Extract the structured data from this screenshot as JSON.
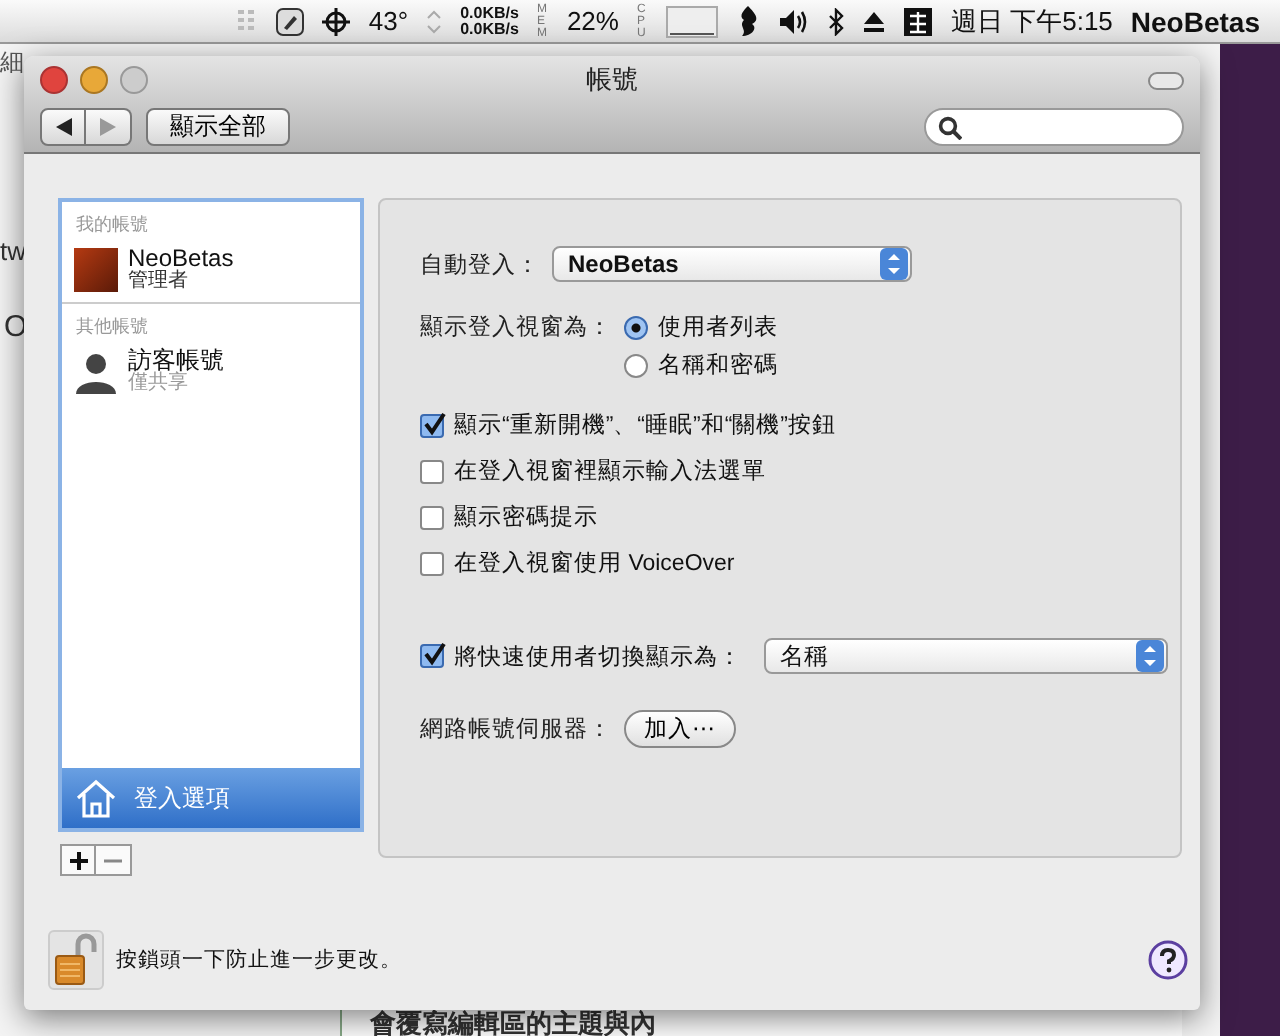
{
  "menu_bar": {
    "temperature": "43°",
    "net_up": "0.0KB/s",
    "net_down": "0.0KB/s",
    "mem_label": "MEM",
    "mem": "22%",
    "cpu_label": "CPU",
    "clock": "週日 下午5:15",
    "user": "NeoBetas"
  },
  "background": {
    "top_left": "細",
    "left_1": "tw",
    "left_2": "O",
    "bottom": "會覆寫編輯區的主題與內"
  },
  "window": {
    "title": "帳號",
    "show_all": "顯示全部"
  },
  "sidebar": {
    "groups": [
      {
        "header": "我的帳號",
        "accounts": [
          {
            "name": "NeoBetas",
            "role": "管理者",
            "kind": "photo",
            "selected": false
          }
        ]
      },
      {
        "header": "其他帳號",
        "accounts": [
          {
            "name": "訪客帳號",
            "role": "僅共享",
            "kind": "guest",
            "selected": false
          }
        ]
      }
    ],
    "login_options": {
      "label": "登入選項",
      "selected": true
    }
  },
  "form": {
    "auto_login": {
      "label": "自動登入：",
      "value": "NeoBetas"
    },
    "login_window": {
      "label": "顯示登入視窗為：",
      "options": [
        {
          "label": "使用者列表",
          "selected": true
        },
        {
          "label": "名稱和密碼",
          "selected": false
        }
      ]
    },
    "checkboxes": [
      {
        "label": "顯示“重新開機”、“睡眠”和“關機”按鈕",
        "checked": true
      },
      {
        "label": "在登入視窗裡顯示輸入法選單",
        "checked": false
      },
      {
        "label": "顯示密碼提示",
        "checked": false
      },
      {
        "label": "在登入視窗使用 VoiceOver",
        "checked": false
      }
    ],
    "fast_switch": {
      "label": "將快速使用者切換顯示為：",
      "checked": true,
      "value": "名稱"
    },
    "network_server": {
      "label": "網路帳號伺服器：",
      "button": "加入⋯"
    }
  },
  "footer": {
    "lock_text": "按鎖頭一下防止進一步更改。"
  }
}
